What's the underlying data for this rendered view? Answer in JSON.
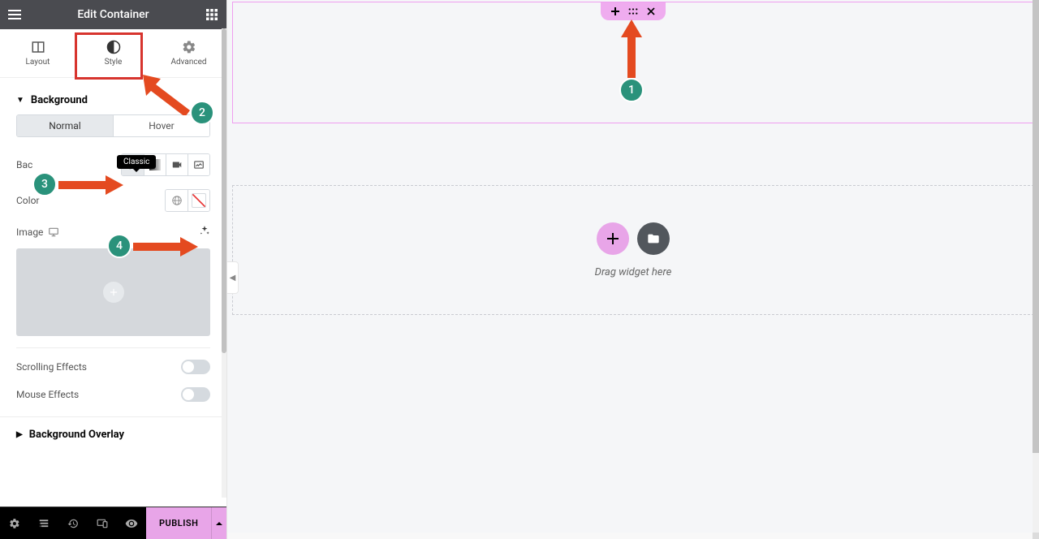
{
  "header": {
    "title": "Edit Container"
  },
  "tabs": {
    "layout": "Layout",
    "style": "Style",
    "advanced": "Advanced"
  },
  "bg": {
    "section": "Background",
    "normal": "Normal",
    "hover": "Hover",
    "type_label": "Bac",
    "tooltip": "Classic",
    "color_label": "Color",
    "image_label": "Image",
    "scroll": "Scrolling Effects",
    "mouse": "Mouse Effects",
    "overlay": "Background Overlay"
  },
  "footer": {
    "publish": "PUBLISH"
  },
  "canvas": {
    "drop_text": "Drag widget here"
  },
  "anno": {
    "1": "1",
    "2": "2",
    "3": "3",
    "4": "4"
  }
}
